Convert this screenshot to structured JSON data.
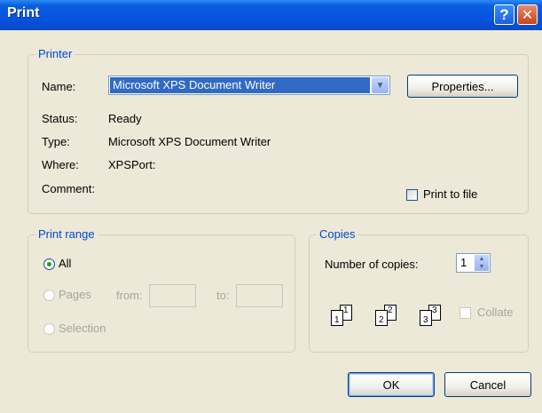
{
  "window": {
    "title": "Print",
    "help_glyph": "?",
    "close_glyph": "✕"
  },
  "printer": {
    "legend": "Printer",
    "name_label": "Name:",
    "name_value": "Microsoft XPS Document Writer",
    "properties_label": "Properties...",
    "status_label": "Status:",
    "status_value": "Ready",
    "type_label": "Type:",
    "type_value": "Microsoft XPS Document Writer",
    "where_label": "Where:",
    "where_value": "XPSPort:",
    "comment_label": "Comment:",
    "print_to_file_label": "Print to file",
    "print_to_file_checked": false
  },
  "print_range": {
    "legend": "Print range",
    "all_label": "All",
    "pages_label": "Pages",
    "from_label": "from:",
    "to_label": "to:",
    "selection_label": "Selection",
    "selected": "All"
  },
  "copies": {
    "legend": "Copies",
    "number_label": "Number of copies:",
    "number_value": "1",
    "collate_label": "Collate",
    "collate_checked": false,
    "collate_pages": [
      {
        "back": "1",
        "front": "1"
      },
      {
        "back": "2",
        "front": "2"
      },
      {
        "back": "3",
        "front": "3"
      }
    ]
  },
  "buttons": {
    "ok_label": "OK",
    "cancel_label": "Cancel"
  },
  "colors": {
    "accent": "#0046d5",
    "titlebar": "#0554e0",
    "selection": "#316ac5",
    "dialog_bg": "#ece9d8"
  },
  "icons": {
    "dropdown": "chevron-down-icon",
    "help": "help-icon",
    "close": "close-icon",
    "spin": "spin-arrows-icon"
  }
}
